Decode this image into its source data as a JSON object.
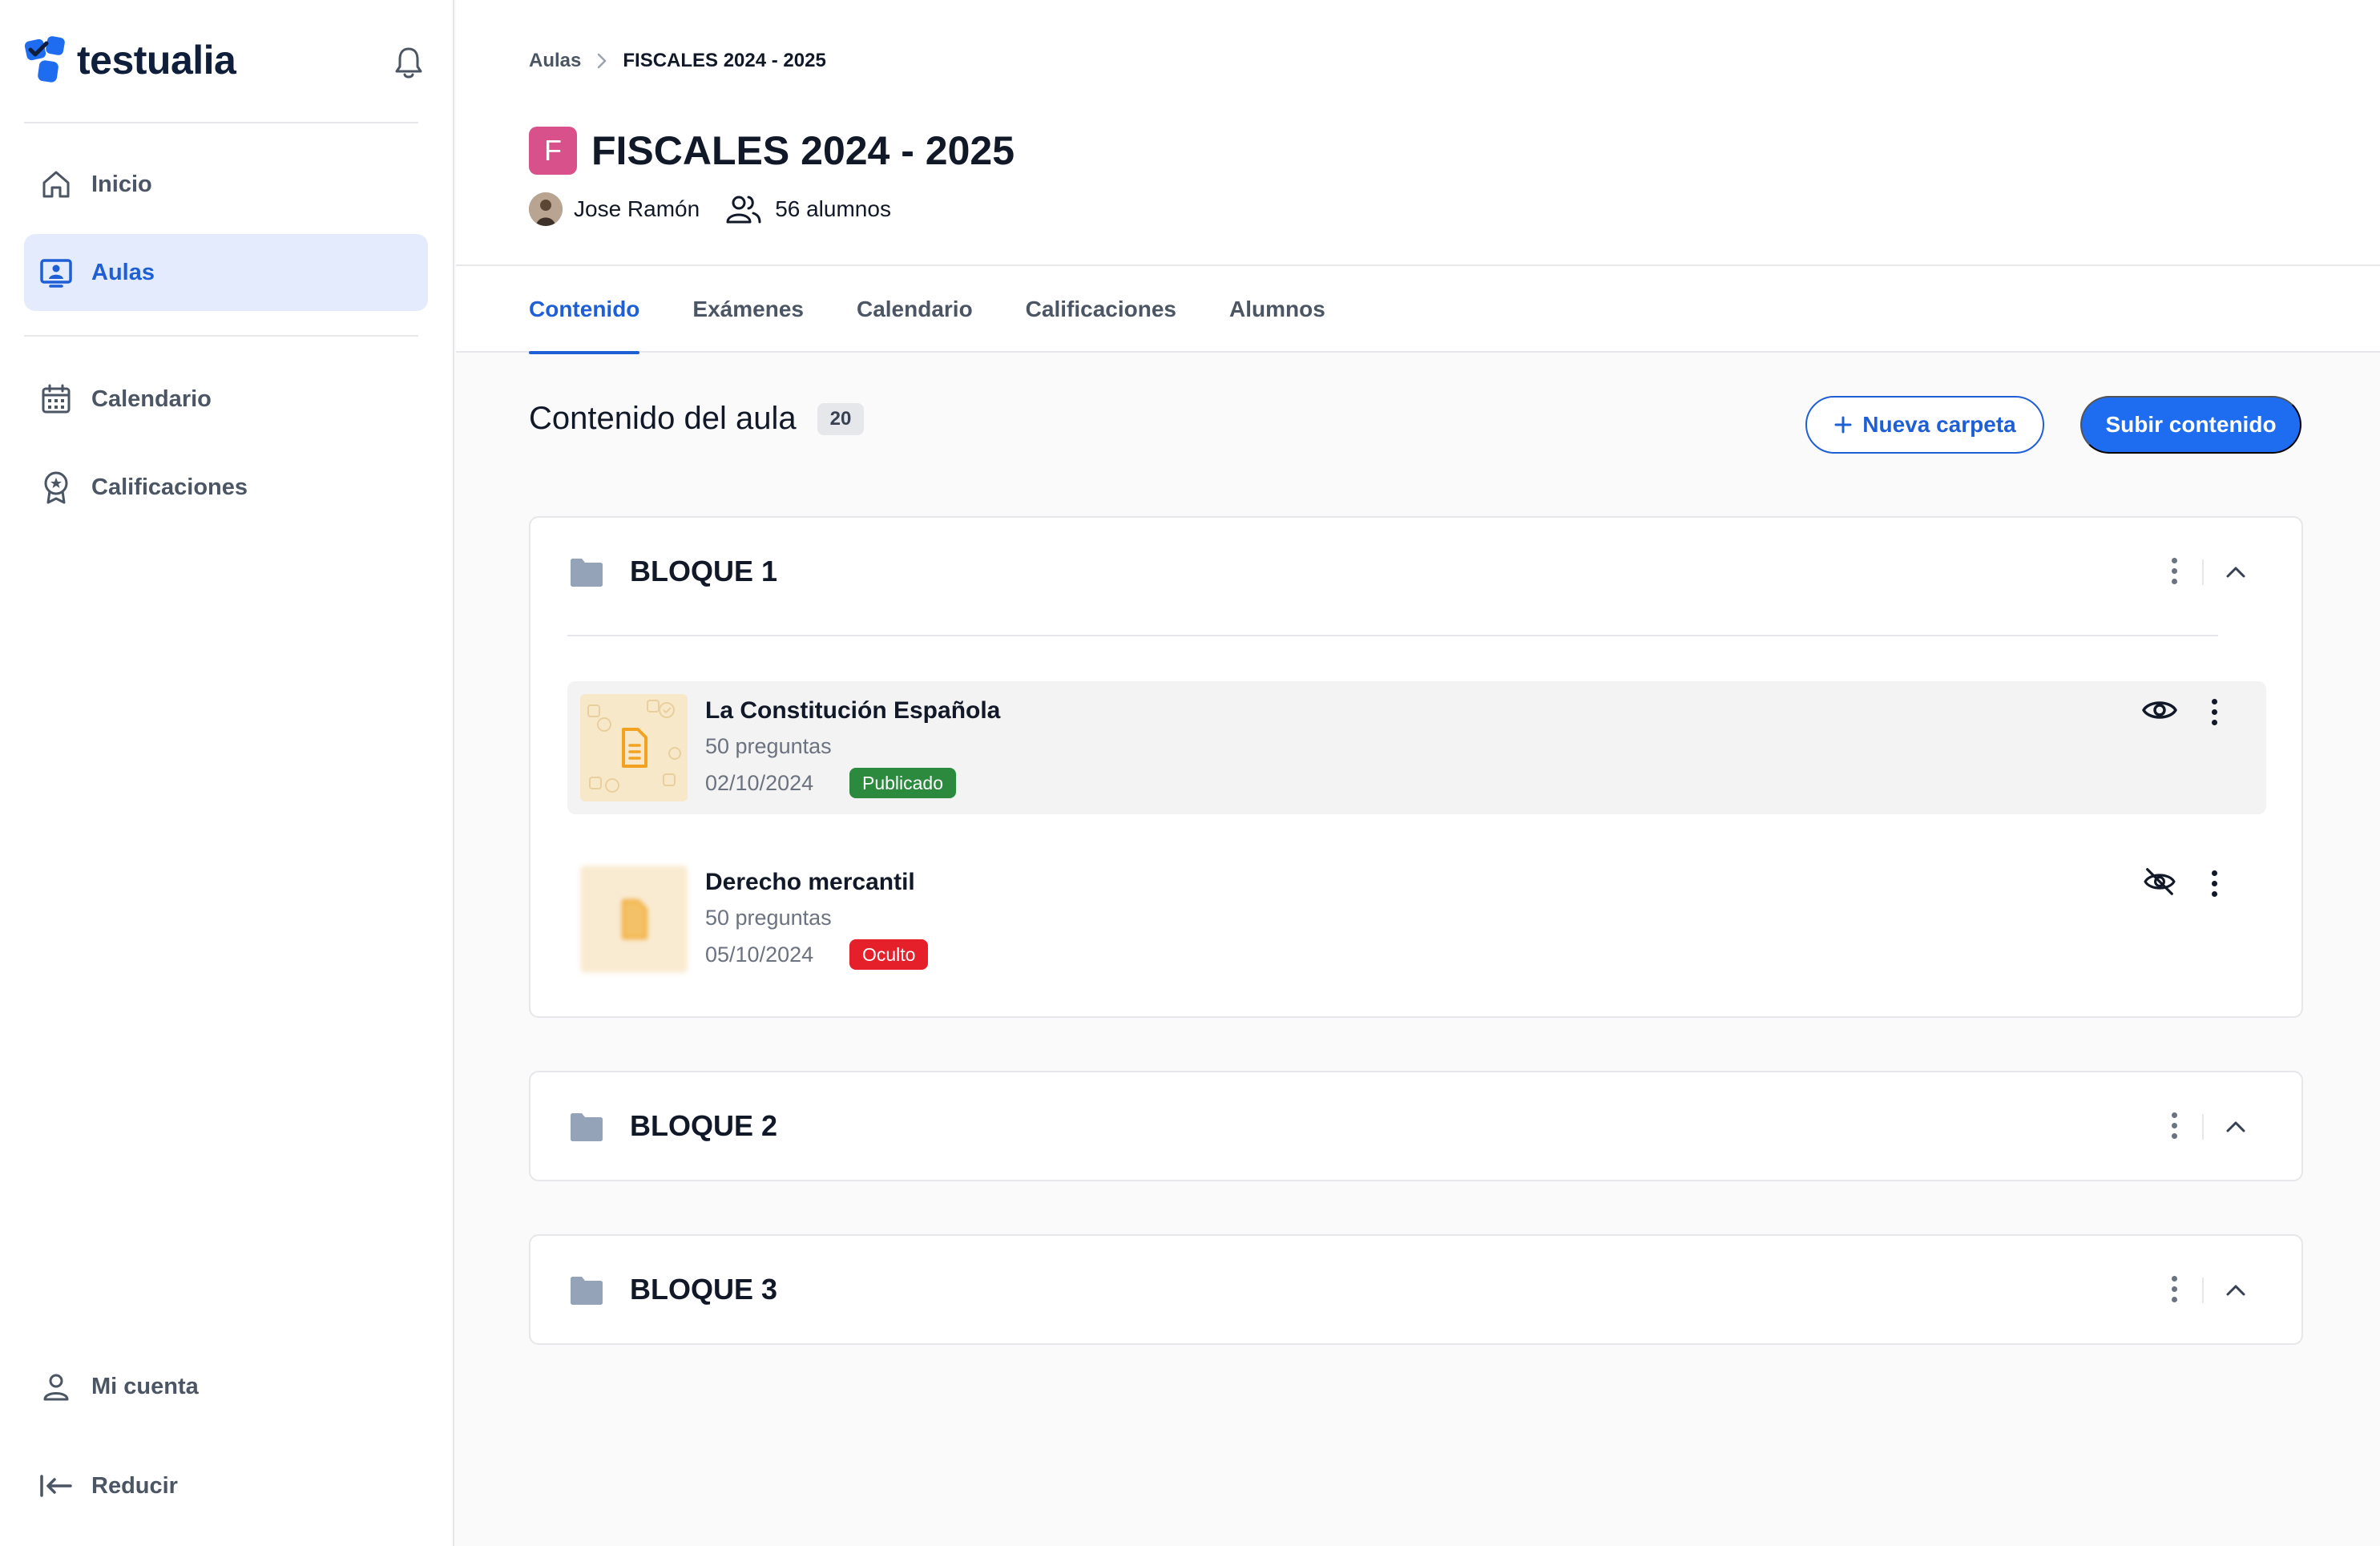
{
  "app": {
    "name": "testualia"
  },
  "sidebar": {
    "items": [
      {
        "label": "Inicio",
        "icon": "home-icon"
      },
      {
        "label": "Aulas",
        "icon": "classroom-icon",
        "active": true
      },
      {
        "label": "Calendario",
        "icon": "calendar-icon"
      },
      {
        "label": "Calificaciones",
        "icon": "award-icon"
      }
    ],
    "footer": [
      {
        "label": "Mi cuenta",
        "icon": "user-icon"
      },
      {
        "label": "Reducir",
        "icon": "collapse-left-icon"
      }
    ]
  },
  "breadcrumb": {
    "parent": "Aulas",
    "current": "FISCALES 2024 - 2025"
  },
  "course": {
    "initial": "F",
    "title": "FISCALES 2024 - 2025",
    "teacher": "Jose Ramón",
    "students": "56 alumnos",
    "badge_color": "#d9518a"
  },
  "tabs": [
    {
      "label": "Contenido",
      "active": true
    },
    {
      "label": "Exámenes"
    },
    {
      "label": "Calendario"
    },
    {
      "label": "Calificaciones"
    },
    {
      "label": "Alumnos"
    }
  ],
  "content": {
    "title": "Contenido del aula",
    "count": "20",
    "new_folder_label": "Nueva carpeta",
    "upload_label": "Subir contenido"
  },
  "folders": [
    {
      "name": "BLOQUE 1",
      "expanded": true,
      "items": [
        {
          "title": "La Constitución Española",
          "questions": "50 preguntas",
          "date": "02/10/2024",
          "status": "Publicado",
          "visible": true
        },
        {
          "title": "Derecho mercantil",
          "questions": "50 preguntas",
          "date": "05/10/2024",
          "status": "Oculto",
          "visible": false
        }
      ]
    },
    {
      "name": "BLOQUE 2"
    },
    {
      "name": "BLOQUE 3"
    }
  ],
  "colors": {
    "accent": "#1e6cf0",
    "published": "#2b8a3e",
    "hidden": "#e5202a"
  }
}
